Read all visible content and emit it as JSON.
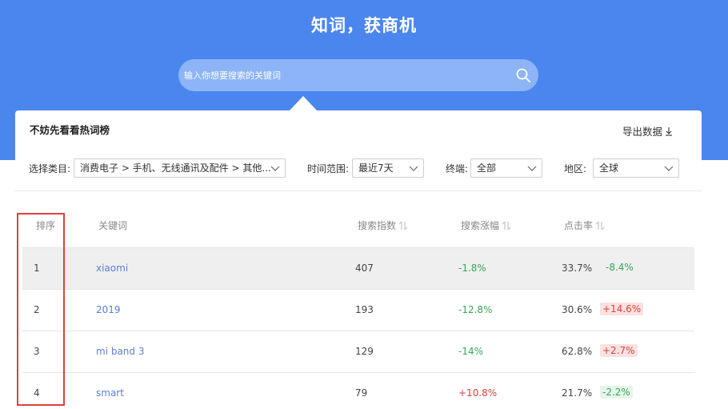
{
  "hero": {
    "title": "知词，获商机"
  },
  "search": {
    "placeholder": "输入你想要搜索的关键词"
  },
  "panel": {
    "title": "不妨先看看热词榜",
    "export_label": "导出数据"
  },
  "filters": [
    {
      "label": "选择类目:",
      "value": "消费电子 > 手机、无线通讯及配件 > 其他..."
    },
    {
      "label": "时间范围:",
      "value": "最近7天"
    },
    {
      "label": "终端:",
      "value": "全部"
    },
    {
      "label": "地区:",
      "value": "全球"
    }
  ],
  "table": {
    "headers": [
      "排序",
      "关键词",
      "搜索指数",
      "搜索涨幅",
      "点击率"
    ],
    "rows": [
      {
        "rank": "1",
        "keyword": "xiaomi",
        "index": "407",
        "growth": "-1.8%",
        "growth_trend": "up-green",
        "ctr": "33.7%",
        "ctr_change": "-8.4%",
        "ctr_trend": "green"
      },
      {
        "rank": "2",
        "keyword": "2019",
        "index": "193",
        "growth": "-12.8%",
        "growth_trend": "green",
        "ctr": "30.6%",
        "ctr_change": "+14.6%",
        "ctr_trend": "red"
      },
      {
        "rank": "3",
        "keyword": "mi band 3",
        "index": "129",
        "growth": "-14%",
        "growth_trend": "green",
        "ctr": "62.8%",
        "ctr_change": "+2.7%",
        "ctr_trend": "red"
      },
      {
        "rank": "4",
        "keyword": "smart",
        "index": "79",
        "growth": "+10.8%",
        "growth_trend": "red",
        "ctr": "21.7%",
        "ctr_change": "-2.2%",
        "ctr_trend": "green"
      }
    ]
  },
  "colors": {
    "brand_blue": "#4b86ef",
    "keyword_link": "#5a7fd6",
    "positive_green": "#3aa55a",
    "negative_red": "#d9443a",
    "highlight_box": "#e0413a"
  }
}
